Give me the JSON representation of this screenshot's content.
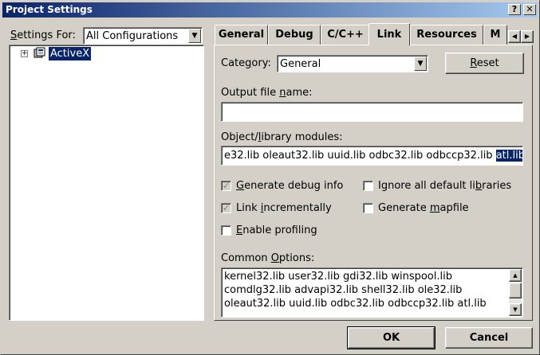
{
  "window": {
    "title": "Project Settings",
    "help_glyph": "?",
    "close_glyph": "✕"
  },
  "settings_for": {
    "label": "Settings For:",
    "selected": "All Configurations"
  },
  "tree": {
    "expander": "+",
    "item_label": "ActiveX"
  },
  "tabs": [
    {
      "label": "General"
    },
    {
      "label": "Debug"
    },
    {
      "label": "C/C++"
    },
    {
      "label": "Link",
      "active": true
    },
    {
      "label": "Resources"
    },
    {
      "label": "M"
    }
  ],
  "tab_scroll": {
    "left": "◀",
    "right": "▶"
  },
  "link": {
    "category_label": "Category:",
    "category_value": "General",
    "reset_label": "Reset",
    "output_label": "Output file name:",
    "output_value": "",
    "modules_label": "Object/library modules:",
    "modules_value_plain": "e32.lib oleaut32.lib uuid.lib odbc32.lib odbccp32.lib ",
    "modules_value_selected": "atl.lib",
    "checkboxes": {
      "generate_debug_info": {
        "label": "Generate debug info",
        "checked": true
      },
      "link_incrementally": {
        "label": "Link incrementally",
        "checked": true
      },
      "enable_profiling": {
        "label": "Enable profiling",
        "checked": false
      },
      "ignore_default_libs": {
        "label": "Ignore all default libraries",
        "checked": false
      },
      "generate_mapfile": {
        "label": "Generate mapfile",
        "checked": false
      }
    },
    "common_options_label": "Common Options:",
    "common_options_lines": [
      "kernel32.lib user32.lib gdi32.lib winspool.lib",
      "comdlg32.lib advapi32.lib shell32.lib ole32.lib",
      "oleaut32.lib uuid.lib odbc32.lib odbccp32.lib atl.lib"
    ]
  },
  "buttons": {
    "ok": "OK",
    "cancel": "Cancel"
  },
  "scroll_arrows": {
    "up": "▲",
    "down": "▼",
    "dropdown": "▼"
  },
  "colors": {
    "face": "#d4d0c8",
    "title_start": "#0a246a",
    "title_end": "#a6caf0",
    "selection": "#0a246a"
  }
}
